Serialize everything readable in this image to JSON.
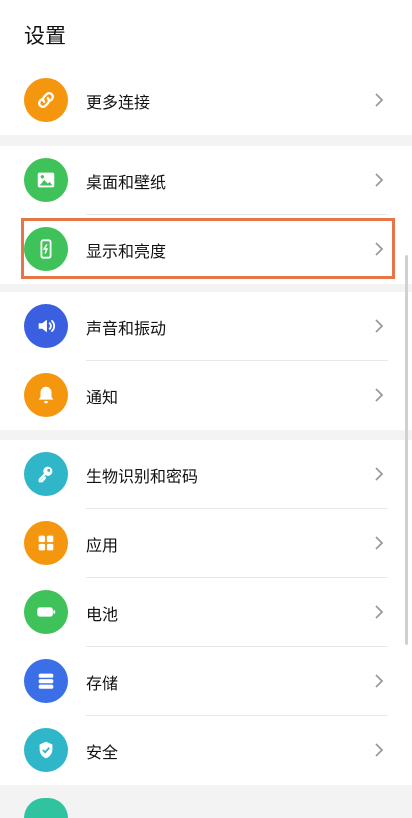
{
  "header": {
    "title": "设置"
  },
  "groups": [
    {
      "items": [
        {
          "label": "更多连接",
          "icon": "link-icon",
          "color": "#f5960f"
        }
      ]
    },
    {
      "items": [
        {
          "label": "桌面和壁纸",
          "icon": "wallpaper-icon",
          "color": "#3fc25a"
        },
        {
          "label": "显示和亮度",
          "icon": "display-brightness-icon",
          "color": "#3fc25a",
          "highlighted": true
        }
      ]
    },
    {
      "items": [
        {
          "label": "声音和振动",
          "icon": "sound-icon",
          "color": "#3a5fe0"
        },
        {
          "label": "通知",
          "icon": "bell-icon",
          "color": "#f5960f"
        }
      ]
    },
    {
      "items": [
        {
          "label": "生物识别和密码",
          "icon": "key-icon",
          "color": "#2fb6c9"
        },
        {
          "label": "应用",
          "icon": "apps-icon",
          "color": "#f5960f"
        },
        {
          "label": "电池",
          "icon": "battery-icon",
          "color": "#3fc25a"
        },
        {
          "label": "存储",
          "icon": "storage-icon",
          "color": "#3a6fe8"
        },
        {
          "label": "安全",
          "icon": "shield-icon",
          "color": "#2fb6c9"
        }
      ]
    }
  ]
}
